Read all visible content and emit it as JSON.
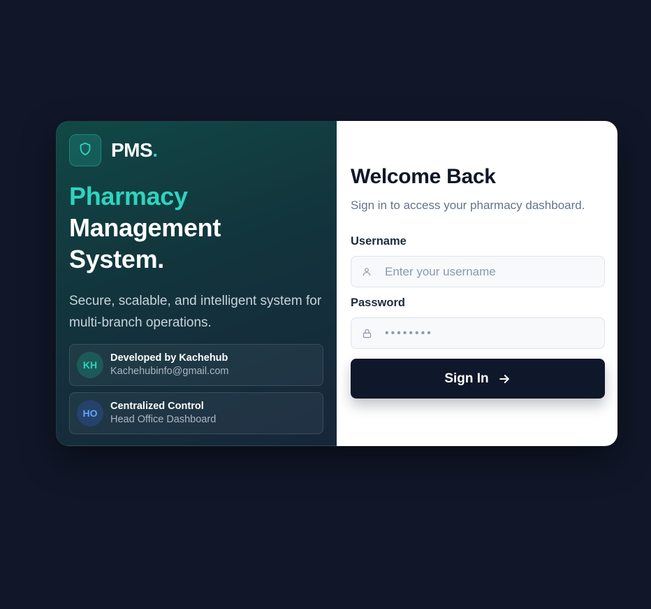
{
  "brand": {
    "name": "PMS",
    "dot": ".",
    "accent_color": "#2dd4bf"
  },
  "hero": {
    "line1": "Pharmacy",
    "line2": "Management",
    "line3": "System.",
    "tagline": "Secure, scalable, and intelligent system for multi-branch operations."
  },
  "info_cards": [
    {
      "initials": "KH",
      "title": "Developed by Kachehub",
      "subtitle": "Kachehubinfo@gmail.com"
    },
    {
      "initials": "HO",
      "title": "Centralized Control",
      "subtitle": "Head Office Dashboard"
    }
  ],
  "login": {
    "title": "Welcome Back",
    "subtitle": "Sign in to access your pharmacy dashboard.",
    "username_label": "Username",
    "username_placeholder": "Enter your username",
    "username_value": "",
    "password_label": "Password",
    "password_value": "••••••••",
    "submit_label": "Sign In"
  },
  "icons": {
    "logo": "shield-icon",
    "username": "user-icon",
    "password": "lock-icon",
    "submit": "arrow-right-icon"
  }
}
